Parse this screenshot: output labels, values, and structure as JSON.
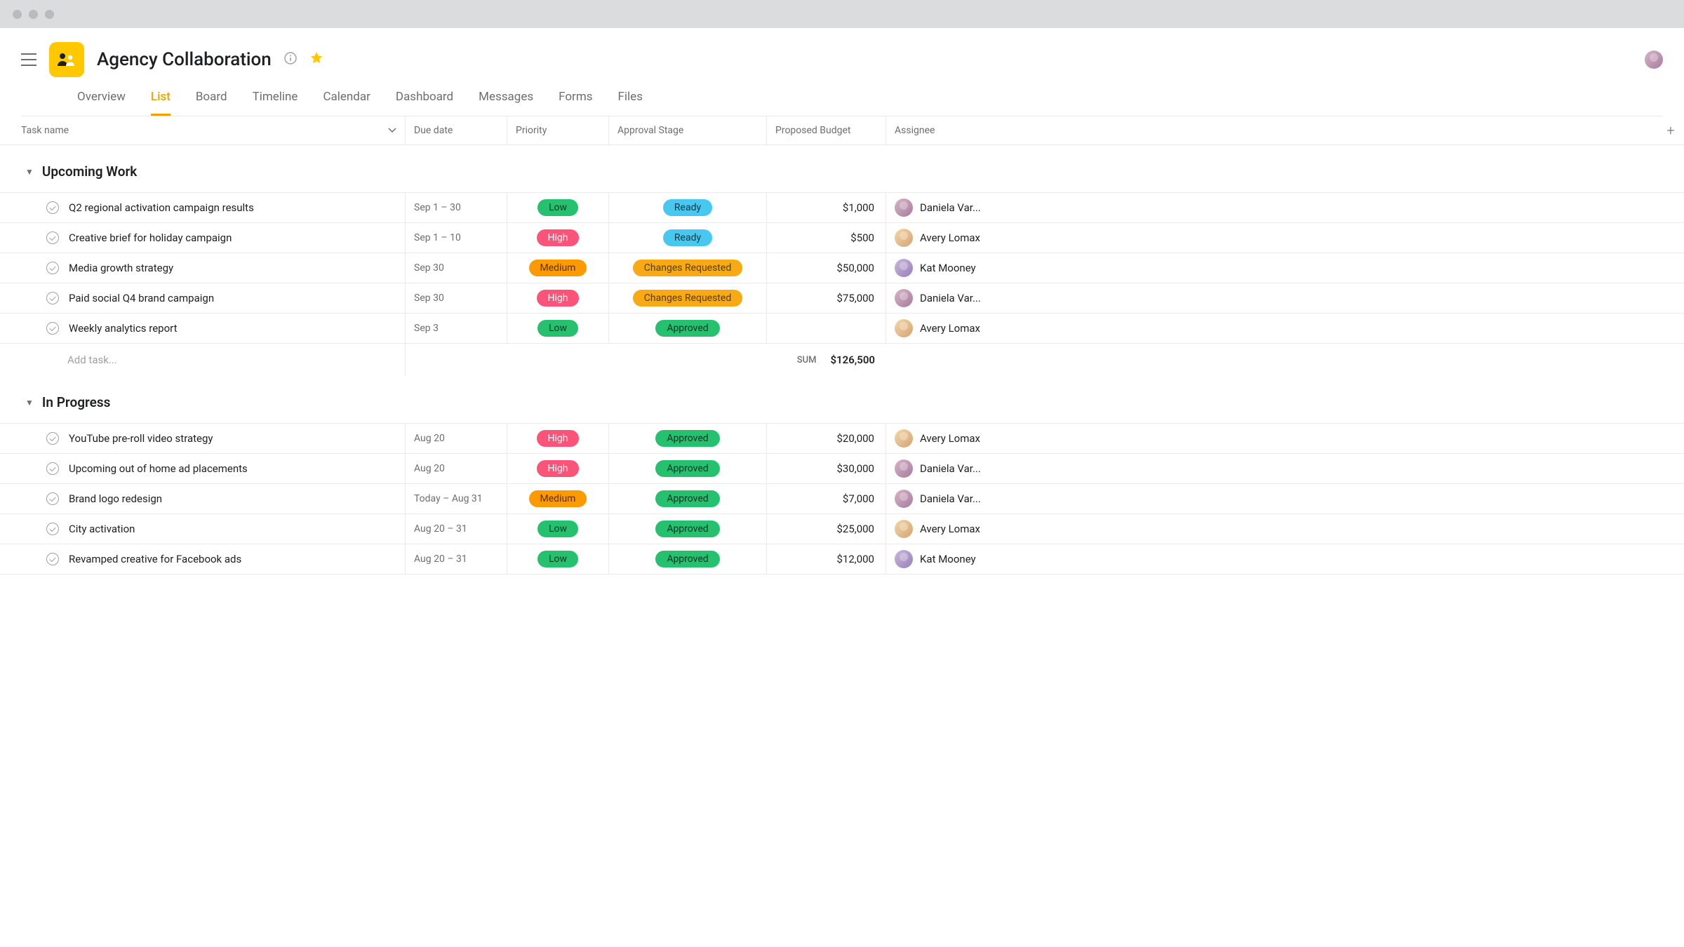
{
  "project": {
    "title": "Agency Collaboration"
  },
  "tabs": [
    "Overview",
    "List",
    "Board",
    "Timeline",
    "Calendar",
    "Dashboard",
    "Messages",
    "Forms",
    "Files"
  ],
  "active_tab": "List",
  "columns": {
    "task": "Task name",
    "due": "Due date",
    "priority": "Priority",
    "approval": "Approval Stage",
    "budget": "Proposed Budget",
    "assignee": "Assignee"
  },
  "sections": [
    {
      "title": "Upcoming Work",
      "tasks": [
        {
          "name": "Q2 regional activation campaign results",
          "due": "Sep 1 – 30",
          "priority": "Low",
          "approval": "Ready",
          "budget": "$1,000",
          "assignee": "Daniela Var...",
          "avatar": "dv"
        },
        {
          "name": "Creative brief for holiday campaign",
          "due": "Sep 1 – 10",
          "priority": "High",
          "approval": "Ready",
          "budget": "$500",
          "assignee": "Avery Lomax",
          "avatar": "al"
        },
        {
          "name": "Media growth strategy",
          "due": "Sep 30",
          "priority": "Medium",
          "approval": "Changes Requested",
          "budget": "$50,000",
          "assignee": "Kat Mooney",
          "avatar": "km"
        },
        {
          "name": "Paid social Q4 brand campaign",
          "due": "Sep 30",
          "priority": "High",
          "approval": "Changes Requested",
          "budget": "$75,000",
          "assignee": "Daniela Var...",
          "avatar": "dv"
        },
        {
          "name": "Weekly analytics report",
          "due": "Sep 3",
          "priority": "Low",
          "approval": "Approved",
          "budget": "",
          "assignee": "Avery Lomax",
          "avatar": "al"
        }
      ],
      "add_task": "Add task...",
      "sum_label": "SUM",
      "sum_value": "$126,500"
    },
    {
      "title": "In Progress",
      "tasks": [
        {
          "name": "YouTube pre-roll video strategy",
          "due": "Aug 20",
          "priority": "High",
          "approval": "Approved",
          "budget": "$20,000",
          "assignee": "Avery Lomax",
          "avatar": "al"
        },
        {
          "name": "Upcoming out of home ad placements",
          "due": "Aug 20",
          "priority": "High",
          "approval": "Approved",
          "budget": "$30,000",
          "assignee": "Daniela Var...",
          "avatar": "dv"
        },
        {
          "name": "Brand logo redesign",
          "due": "Today – Aug 31",
          "priority": "Medium",
          "approval": "Approved",
          "budget": "$7,000",
          "assignee": "Daniela Var...",
          "avatar": "dv"
        },
        {
          "name": "City activation",
          "due": "Aug 20 – 31",
          "priority": "Low",
          "approval": "Approved",
          "budget": "$25,000",
          "assignee": "Avery Lomax",
          "avatar": "al"
        },
        {
          "name": "Revamped creative for Facebook ads",
          "due": "Aug 20 – 31",
          "priority": "Low",
          "approval": "Approved",
          "budget": "$12,000",
          "assignee": "Kat Mooney",
          "avatar": "km"
        }
      ]
    }
  ],
  "priority_classes": {
    "Low": "pill-low",
    "High": "pill-high",
    "Medium": "pill-medium"
  },
  "approval_classes": {
    "Ready": "pill-ready",
    "Changes Requested": "pill-changes",
    "Approved": "pill-approved"
  }
}
